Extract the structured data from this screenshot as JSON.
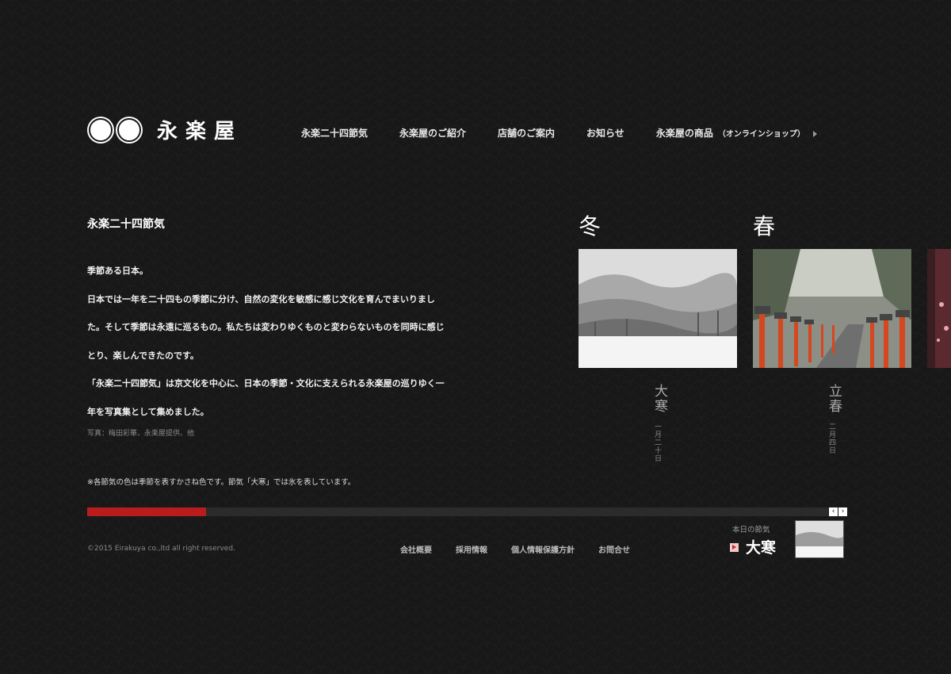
{
  "header": {
    "logo_text": "永楽屋",
    "nav": [
      {
        "label": "永楽二十四節気"
      },
      {
        "label": "永楽屋のご紹介"
      },
      {
        "label": "店舗のご案内"
      },
      {
        "label": "お知らせ"
      },
      {
        "label": "永楽屋の商品",
        "sub": "（オンラインショップ）"
      }
    ]
  },
  "intro": {
    "title": "永楽二十四節気",
    "paragraphs": [
      "季節ある日本。",
      "日本では一年を二十四もの季節に分け、自然の変化を敏感に感じ文化を育んでまいりまし",
      "た。そして季節は永遠に巡るもの。私たちは変わりゆくものと変わらないものを同時に感じ",
      "とり、楽しんできたのです。",
      "「永楽二十四節気」は京文化を中心に、日本の季節・文化に支えられる永楽屋の巡りゆく一",
      "年を写真集として集めました。"
    ],
    "credit": "写真：梅田彩華、永楽屋提供、他",
    "note": "※各節気の色は季節を表すかさね色です。節気「大寒」では氷を表しています。"
  },
  "seasons": [
    {
      "label": "冬"
    },
    {
      "label": "春"
    }
  ],
  "sekki": [
    {
      "name": "大寒",
      "date": "一月二十日",
      "image": "snowy-mountain-landscape"
    },
    {
      "name": "立春",
      "date": "二月四日",
      "image": "shrine-lanterns-stairs"
    }
  ],
  "progress": {
    "percent": 16
  },
  "pager": {
    "prev": "‹",
    "next": "›"
  },
  "footer": {
    "copyright": "©2015 Eirakuya co.,ltd all right reserved.",
    "links": [
      "会社概要",
      "採用情報",
      "個人情報保護方針",
      "お問合せ"
    ]
  },
  "today": {
    "label": "本日の節気",
    "name": "大寒"
  },
  "colors": {
    "accent": "#b81c1c",
    "background": "#181818"
  }
}
